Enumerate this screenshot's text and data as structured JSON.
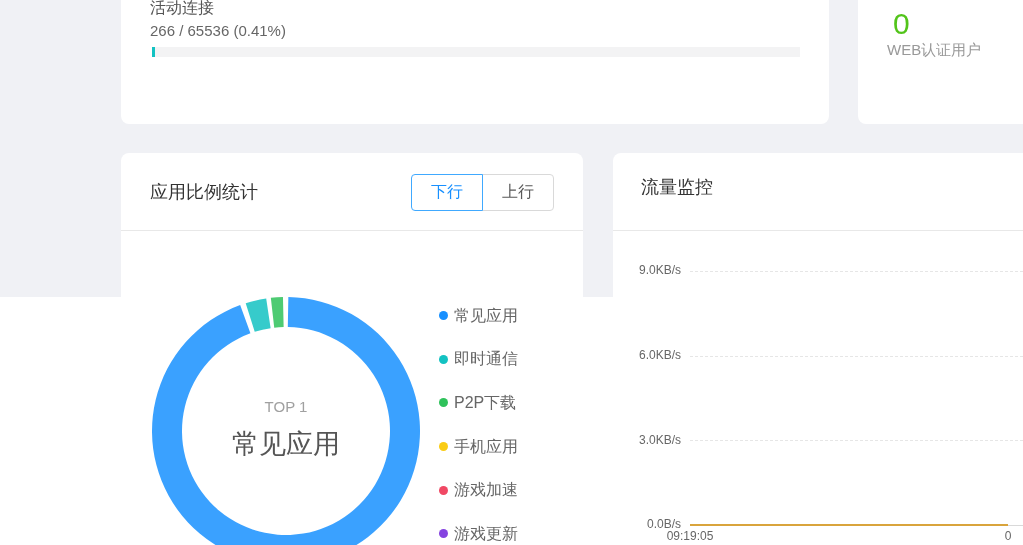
{
  "connections": {
    "title": "活动连接",
    "reading": "266 / 65536 (0.41%)",
    "level": 0.0041
  },
  "web_auth": {
    "value": "0",
    "label": "WEB认证用户"
  },
  "app_ratio": {
    "title": "应用比例统计",
    "toggles": [
      {
        "label": "下行",
        "selected": true
      },
      {
        "label": "上行",
        "selected": false
      }
    ],
    "donut": {
      "caption": "TOP 1",
      "label": "常见应用"
    },
    "legend": [
      {
        "label": "常见应用",
        "color": "#1890ff"
      },
      {
        "label": "即时通信",
        "color": "#13c2c2"
      },
      {
        "label": "P2P下载",
        "color": "#2fc25b"
      },
      {
        "label": "手机应用",
        "color": "#facc14"
      },
      {
        "label": "游戏加速",
        "color": "#f04864"
      },
      {
        "label": "游戏更新",
        "color": "#8543e0"
      }
    ]
  },
  "traffic": {
    "title": "流量监控",
    "chart_data": {
      "type": "line",
      "categories": [
        "09:19:05",
        "0"
      ],
      "series": [
        {
          "color": "#d9a43c",
          "values": [
            0,
            0
          ]
        }
      ],
      "ylim": [
        0,
        9
      ],
      "yticks": [
        {
          "value": 0,
          "label": "0.0B/s"
        },
        {
          "value": 3,
          "label": "3.0KB/s"
        },
        {
          "value": 6,
          "label": "6.0KB/s"
        },
        {
          "value": 9,
          "label": "9.0KB/s"
        }
      ]
    }
  }
}
